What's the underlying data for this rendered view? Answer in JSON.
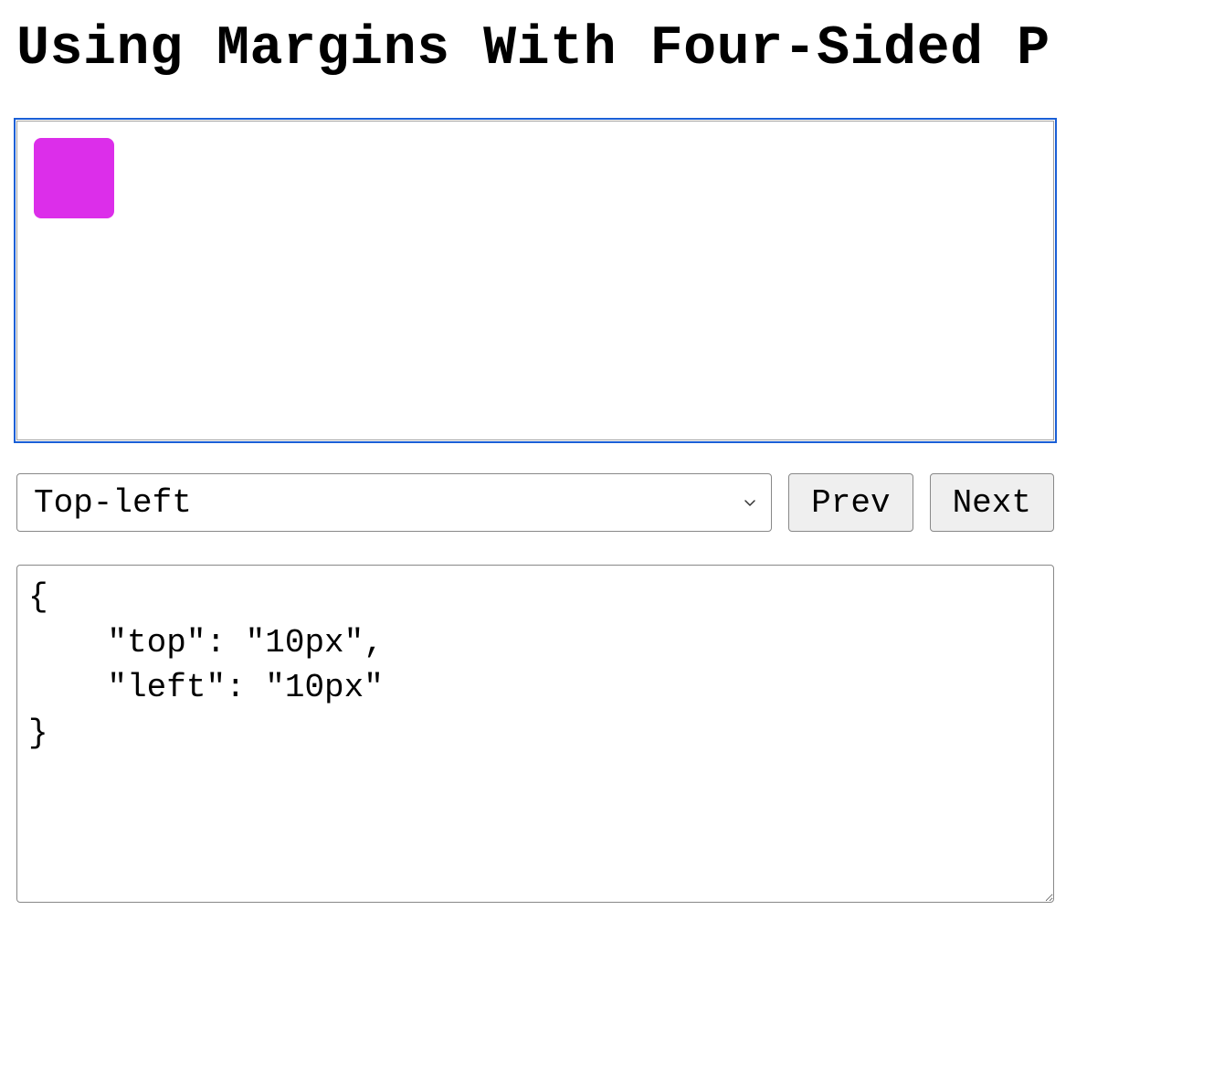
{
  "page": {
    "title": "Using Margins With Four-Sided P"
  },
  "canvas": {
    "box_color": "#dc2eea"
  },
  "controls": {
    "position_select": {
      "selected": "Top-left",
      "options": [
        "Top-left"
      ]
    },
    "prev_label": "Prev",
    "next_label": "Next"
  },
  "code": {
    "text": "{\n\t\"top\": \"10px\",\n\t\"left\": \"10px\"\n}"
  }
}
